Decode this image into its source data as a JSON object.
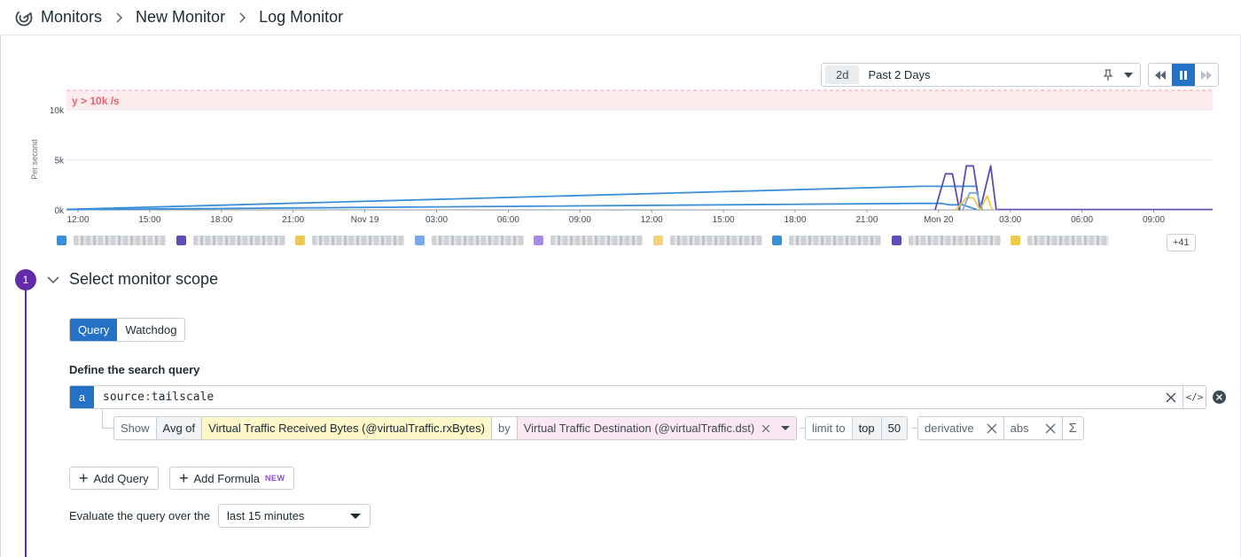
{
  "breadcrumb": {
    "items": [
      "Monitors",
      "New Monitor",
      "Log Monitor"
    ]
  },
  "timepicker": {
    "badge": "2d",
    "label": "Past 2 Days"
  },
  "chart_data": {
    "type": "line",
    "ylabel": "Per second",
    "ylim": [
      0,
      10000
    ],
    "y_ticks": [
      "10k",
      "5k",
      "0k"
    ],
    "x_ticks": [
      "12:00",
      "15:00",
      "18:00",
      "21:00",
      "Nov 19",
      "03:00",
      "06:00",
      "09:00",
      "12:00",
      "15:00",
      "18:00",
      "21:00",
      "Mon 20",
      "03:00",
      "06:00",
      "09:00"
    ],
    "threshold": {
      "label": "y > 10k /s",
      "value": 10000,
      "color": "#f28b95"
    },
    "grid": true,
    "series_colors": [
      "#3b8fd9",
      "#5a4fb8",
      "#f0c84a",
      "#7ba7e8",
      "#a98be6",
      "#f5d37a"
    ],
    "series": [
      {
        "points": [
          [
            0,
            50
          ],
          [
            12.3,
            2350
          ],
          [
            13.1,
            2350
          ]
        ],
        "color": "#3b8fd9"
      },
      {
        "points": [
          [
            0,
            30
          ],
          [
            12.2,
            650
          ],
          [
            12.6,
            650
          ],
          [
            12.7,
            500
          ],
          [
            12.9,
            500
          ],
          [
            13.1,
            30
          ]
        ],
        "color": "#3b8fd9"
      },
      {
        "points": [
          [
            12.5,
            0
          ],
          [
            12.65,
            3600
          ],
          [
            12.75,
            3600
          ],
          [
            12.85,
            0
          ],
          [
            12.95,
            4400
          ],
          [
            13.05,
            4400
          ],
          [
            13.15,
            0
          ],
          [
            13.3,
            4400
          ],
          [
            13.38,
            0
          ]
        ],
        "color": "#5a4fb8"
      },
      {
        "points": [
          [
            12.8,
            0
          ],
          [
            12.95,
            1200
          ],
          [
            13.05,
            1200
          ],
          [
            13.15,
            0
          ],
          [
            13.25,
            1400
          ],
          [
            13.32,
            0
          ]
        ],
        "color": "#f0c84a"
      },
      {
        "points": [
          [
            12.9,
            0
          ],
          [
            13.0,
            1700
          ],
          [
            13.1,
            1700
          ],
          [
            13.18,
            0
          ]
        ],
        "color": "#7ba7e8"
      }
    ]
  },
  "legend": {
    "items": [
      {
        "color": "#3b8fd9",
        "blur_w": 104
      },
      {
        "color": "#5a4fb8",
        "blur_w": 104
      },
      {
        "color": "#f0c84a",
        "blur_w": 104
      },
      {
        "color": "#7ba7e8",
        "blur_w": 104
      },
      {
        "color": "#a98be6",
        "blur_w": 104
      },
      {
        "color": "#f5d37a",
        "blur_w": 104
      },
      {
        "color": "#3b8fd9",
        "blur_w": 104
      },
      {
        "color": "#5a4fb8",
        "blur_w": 104
      },
      {
        "color": "#f0c84a",
        "blur_w": 92
      }
    ],
    "more_label": "+41"
  },
  "step": {
    "number": "1",
    "title": "Select monitor scope"
  },
  "tabs": {
    "query": "Query",
    "watchdog": "Watchdog"
  },
  "define_label": "Define the search query",
  "query": {
    "letter": "a",
    "key": "source",
    "value": "tailscale",
    "code_icon": "</>"
  },
  "formula": {
    "show": "Show",
    "agg": "Avg of",
    "measure": "Virtual Traffic Received Bytes (@virtualTraffic.rxBytes)",
    "by": "by",
    "group": "Virtual Traffic Destination (@virtualTraffic.dst)",
    "limit_to": "limit to",
    "top": "top",
    "limit_n": "50",
    "fn1": "derivative",
    "fn2": "abs",
    "sigma": "Σ"
  },
  "buttons": {
    "add_query": "Add Query",
    "add_formula": "Add Formula",
    "new_badge": "NEW"
  },
  "evaluate": {
    "label": "Evaluate the query over the",
    "value": "last 15 minutes"
  }
}
